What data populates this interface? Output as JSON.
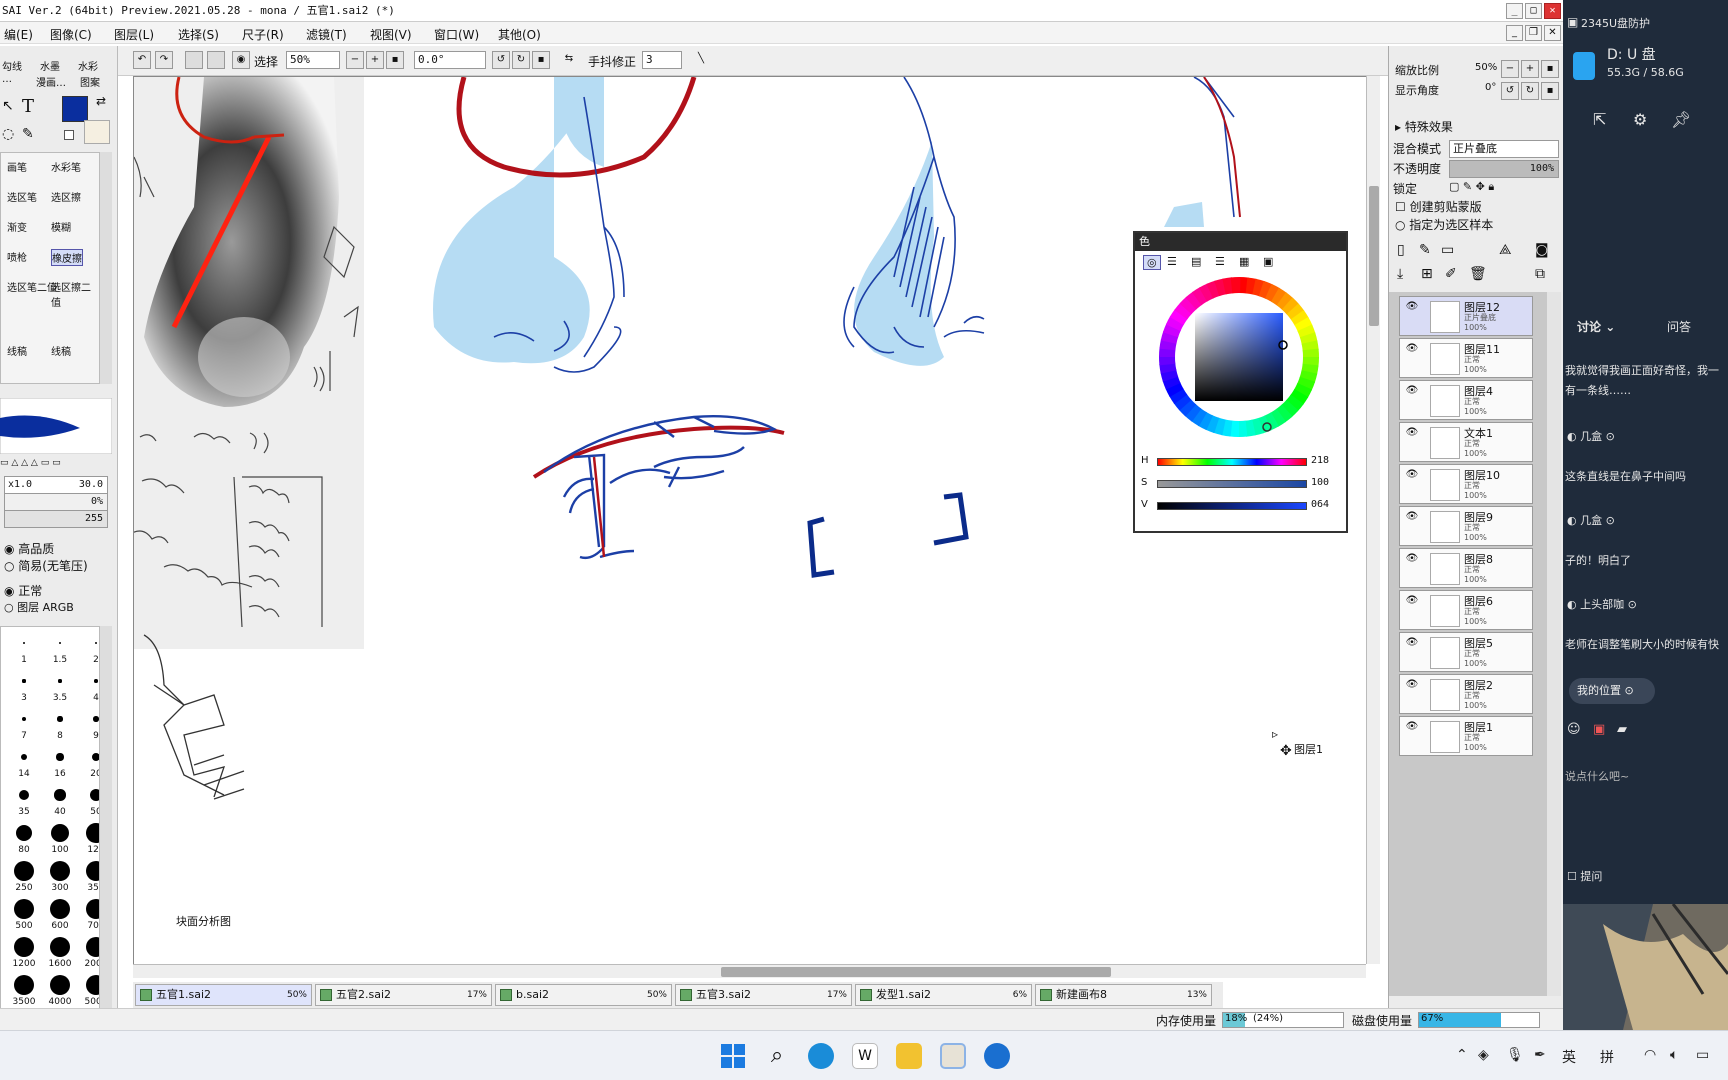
{
  "window": {
    "title": "SAI Ver.2 (64bit) Preview.2021.05.28 - mona / 五官1.sai2 (*)"
  },
  "menu": [
    "编(E)",
    "图像(C)",
    "图层(L)",
    "选择(S)",
    "尺子(R)",
    "滤镜(T)",
    "视图(V)",
    "窗口(W)",
    "其他(O)"
  ],
  "toolbar": {
    "select_label": "选择",
    "zoom_value": "50%",
    "angle_value": "0.0°",
    "stabilizer_label": "手抖修正",
    "stabilizer_value": "3"
  },
  "left_panel": {
    "tool_tabs": [
      "勾线",
      "水墨",
      "水彩"
    ],
    "tool_tabs2": [
      "…",
      "漫画…",
      "图案"
    ],
    "tools": [
      [
        "画笔",
        "水彩笔"
      ],
      [
        "选区笔",
        "选区擦"
      ],
      [
        "渐变",
        "模糊"
      ],
      [
        "喷枪",
        "橡皮擦"
      ],
      [
        "选区笔二值",
        "选区擦二值"
      ],
      [
        "线稿",
        "线稿"
      ]
    ],
    "size_label": "x1.0",
    "size_value": "30.0",
    "density_value": "0%",
    "opacity_value": "255",
    "quality_high": "高品质",
    "quality_simple": "简易(无笔压)",
    "blend_normal": "正常",
    "blend_layer": "图层 ARGB",
    "brush_sizes": [
      "1",
      "1.5",
      "2",
      "3",
      "3.5",
      "4",
      "7",
      "8",
      "9",
      "14",
      "16",
      "20",
      "35",
      "40",
      "50",
      "80",
      "100",
      "120",
      "250",
      "300",
      "350",
      "500",
      "600",
      "700",
      "1200",
      "1600",
      "2000",
      "3500",
      "4000",
      "5000"
    ]
  },
  "canvas": {
    "annotation_caption": "块面分析图",
    "cursor_layer_label": "图层1"
  },
  "file_tabs": [
    {
      "name": "五官1.sai2",
      "pct": "50%"
    },
    {
      "name": "五官2.sai2",
      "pct": "17%"
    },
    {
      "name": "b.sai2",
      "pct": "50%"
    },
    {
      "name": "五官3.sai2",
      "pct": "17%"
    },
    {
      "name": "发型1.sai2",
      "pct": "6%"
    },
    {
      "name": "新建画布8",
      "pct": "13%"
    }
  ],
  "status": {
    "memory_label": "内存使用量",
    "memory_value": "18%",
    "memory_extra": "(24%)",
    "disk_label": "磁盘使用量",
    "disk_value": "67%"
  },
  "right_panel": {
    "zoom_label": "缩放比例",
    "zoom_value": "50%",
    "angle_label": "显示角度",
    "angle_value": "0°",
    "effects_label": "特殊效果",
    "blend_label": "混合模式",
    "blend_value": "正片叠底",
    "opacity_label": "不透明度",
    "opacity_value": "100%",
    "lock_label": "锁定",
    "clip_label": "创建剪贴蒙版",
    "select_src_label": "指定为选区样本",
    "layers": [
      {
        "name": "图层12",
        "mode": "正片叠底",
        "opacity": "100%",
        "active": true
      },
      {
        "name": "图层11",
        "mode": "正常",
        "opacity": "100%"
      },
      {
        "name": "图层4",
        "mode": "正常",
        "opacity": "100%"
      },
      {
        "name": "文本1",
        "mode": "正常",
        "opacity": "100%"
      },
      {
        "name": "图层10",
        "mode": "正常",
        "opacity": "100%"
      },
      {
        "name": "图层9",
        "mode": "正常",
        "opacity": "100%"
      },
      {
        "name": "图层8",
        "mode": "正常",
        "opacity": "100%"
      },
      {
        "name": "图层6",
        "mode": "正常",
        "opacity": "100%"
      },
      {
        "name": "图层5",
        "mode": "正常",
        "opacity": "100%"
      },
      {
        "name": "图层2",
        "mode": "正常",
        "opacity": "100%"
      },
      {
        "name": "图层1",
        "mode": "正常",
        "opacity": "100%"
      }
    ]
  },
  "color_dialog": {
    "title": "色",
    "h_label": "H",
    "h_value": "218",
    "s_label": "S",
    "s_value": "100",
    "v_label": "V",
    "v_value": "064",
    "primary_color": "#0a2e9e",
    "secondary_color": "#f5efe1"
  },
  "sidebar": {
    "protect_label": "2345U盘防护",
    "drive_label": "D: U 盘",
    "drive_space": "55.3G / 58.6G",
    "tab_discuss": "讨论",
    "tab_qa": "问答",
    "messages": [
      {
        "user": "",
        "text": "我就觉得我画正面好奇怪，我一"
      },
      {
        "user": "",
        "text": "有一条线……"
      },
      {
        "user": "几盒",
        "text": ""
      },
      {
        "user": "",
        "text": "这条直线是在鼻子中间吗"
      },
      {
        "user": "几盒",
        "text": ""
      },
      {
        "user": "",
        "text": "子的！明白了"
      },
      {
        "user": "上头部咖",
        "text": ""
      },
      {
        "user": "",
        "text": "老师在调整笔刷大小的时候有快"
      }
    ],
    "location_label": "我的位置",
    "input_placeholder": "说点什么吧~",
    "ask_label": "提问"
  },
  "taskbar": {
    "ime_lang": "英",
    "ime_mode": "拼"
  }
}
